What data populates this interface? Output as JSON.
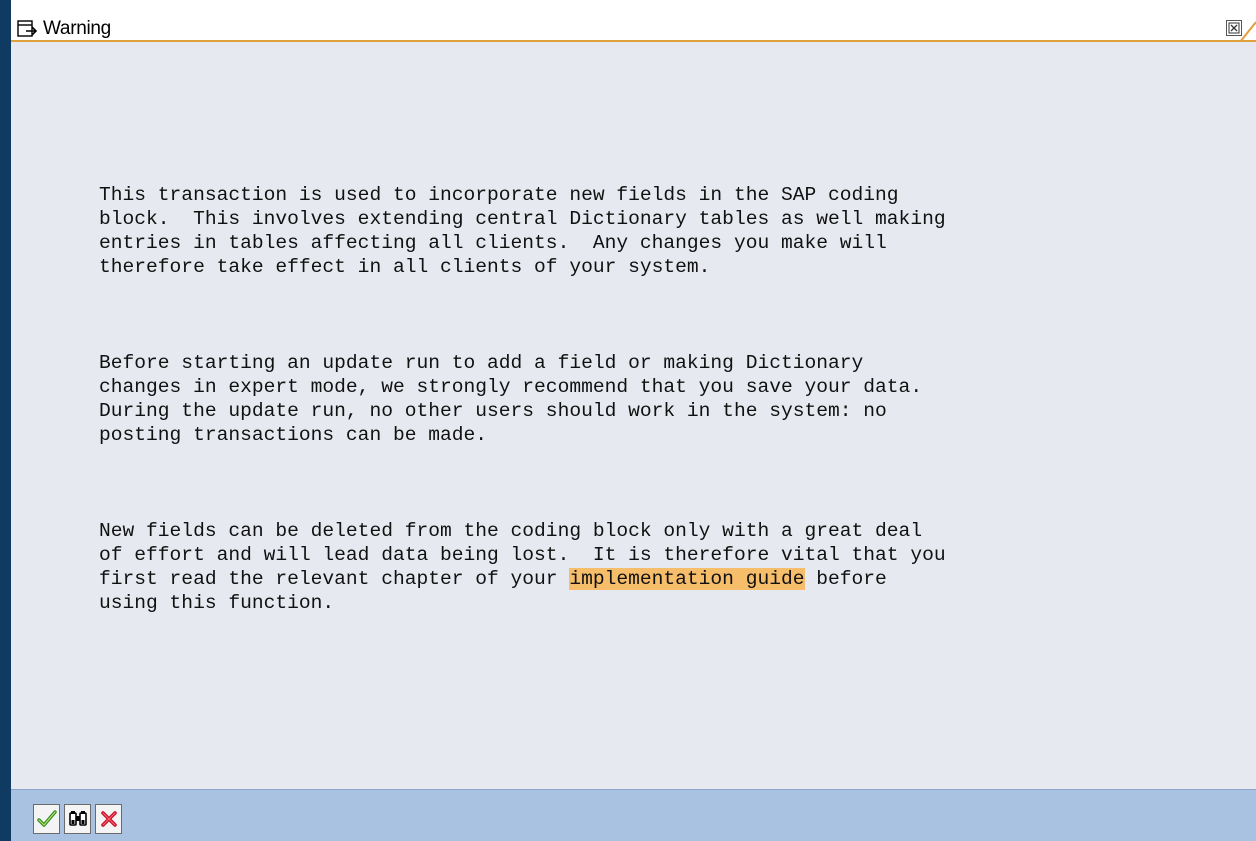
{
  "window": {
    "title": "Warning",
    "title_icon": "window-menu-icon",
    "close_icon": "close-icon"
  },
  "message": {
    "paragraphs": [
      "This transaction is used to incorporate new fields in the SAP coding\nblock.  This involves extending central Dictionary tables as well making\nentries in tables affecting all clients.  Any changes you make will\ntherefore take effect in all clients of your system.",
      "Before starting an update run to add a field or making Dictionary\nchanges in expert mode, we strongly recommend that you save your data.\nDuring the update run, no other users should work in the system: no\nposting transactions can be made.",
      "New fields can be deleted from the coding block only with a great deal\nof effort and will lead data being lost.  It is therefore vital that you\nfirst read the relevant chapter of your "
    ],
    "link_text": "implementation guide",
    "after_link": " before\nusing this function."
  },
  "toolbar": {
    "buttons": [
      {
        "name": "continue-button",
        "icon": "checkmark-icon"
      },
      {
        "name": "find-button",
        "icon": "binoculars-icon"
      },
      {
        "name": "cancel-button",
        "icon": "red-x-icon"
      }
    ]
  },
  "colors": {
    "background": "#e6eaf0",
    "title_accent": "#e0a03a",
    "toolbar": "#a9c2e2",
    "link_highlight": "#f6bd6b",
    "left_edge": "#0f3a61"
  }
}
